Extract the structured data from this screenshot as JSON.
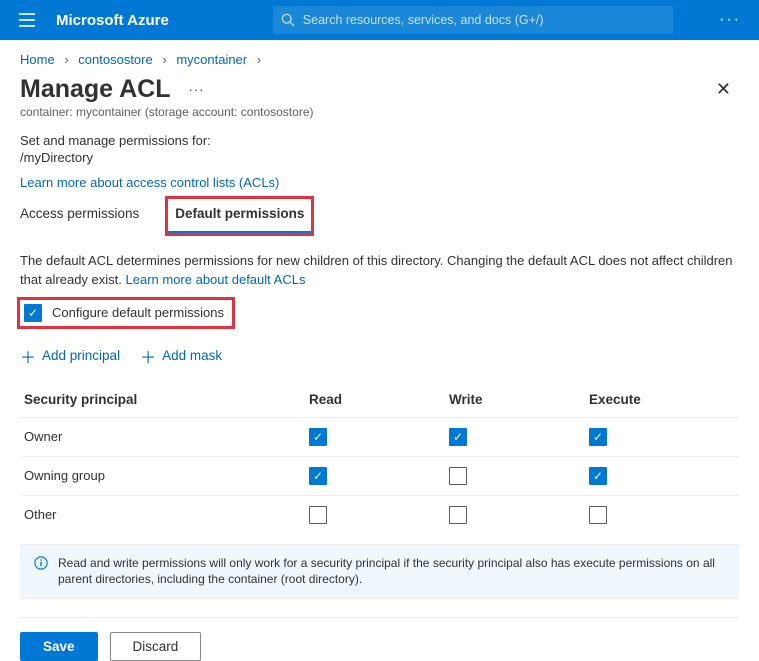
{
  "header": {
    "brand": "Microsoft Azure",
    "search_placeholder": "Search resources, services, and docs (G+/)"
  },
  "breadcrumb": {
    "items": [
      "Home",
      "contosostore",
      "mycontainer"
    ]
  },
  "title": "Manage ACL",
  "subtitle": "container: mycontainer (storage account: contosostore)",
  "permfor_label": "Set and manage permissions for:",
  "permfor_path": "/myDirectory",
  "learn_acls": "Learn more about access control lists (ACLs)",
  "tabs": {
    "access": "Access permissions",
    "default": "Default permissions"
  },
  "default_text1": "The default ACL determines permissions for new children of this directory. Changing the default ACL does not affect children that already exist. ",
  "default_learn": "Learn more about default ACLs",
  "configure_label": "Configure default permissions",
  "add_principal": "Add principal",
  "add_mask": "Add mask",
  "table": {
    "col_principal": "Security principal",
    "col_read": "Read",
    "col_write": "Write",
    "col_execute": "Execute",
    "rows": [
      {
        "name": "Owner",
        "read": true,
        "write": true,
        "execute": true
      },
      {
        "name": "Owning group",
        "read": true,
        "write": false,
        "execute": true
      },
      {
        "name": "Other",
        "read": false,
        "write": false,
        "execute": false
      }
    ]
  },
  "info_text": "Read and write permissions will only work for a security principal if the security principal also has execute permissions on all parent directories, including the container (root directory).",
  "buttons": {
    "save": "Save",
    "discard": "Discard"
  }
}
